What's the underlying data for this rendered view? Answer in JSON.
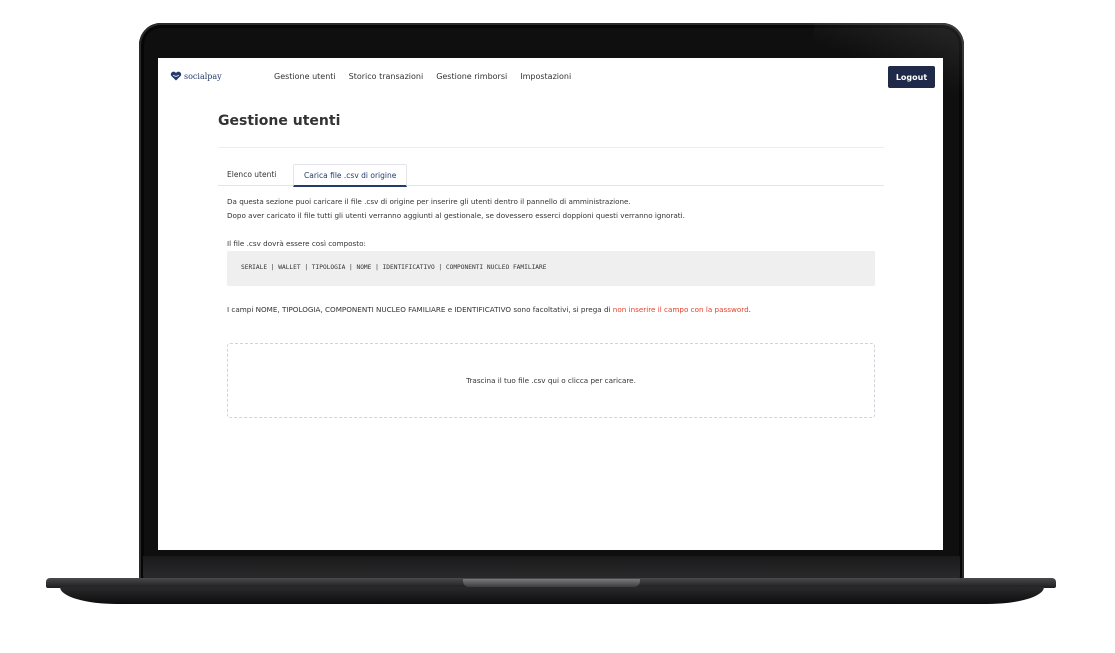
{
  "app": {
    "brand": "socialpay",
    "brand_color": "#243b6b"
  },
  "nav": {
    "items": [
      {
        "label": "Gestione utenti"
      },
      {
        "label": "Storico transazioni"
      },
      {
        "label": "Gestione rimborsi"
      },
      {
        "label": "Impostazioni"
      }
    ],
    "logout_label": "Logout"
  },
  "page": {
    "title": "Gestione utenti"
  },
  "tabs": [
    {
      "label": "Elenco utenti",
      "active": false
    },
    {
      "label": "Carica file .csv di origine",
      "active": true
    }
  ],
  "upload": {
    "desc_line1": "Da questa sezione puoi caricare il file .csv di origine per inserire gli utenti dentro il pannello di amministrazione.",
    "desc_line2": "Dopo aver caricato il file tutti gli utenti verranno aggiunti al gestionale, se dovessero esserci doppioni questi verranno ignorati.",
    "format_intro": "Il file .csv dovrà essere così composto:",
    "format_code": "SERIALE | WALLET | TIPOLOGIA | NOME | IDENTIFICATIVO | COMPONENTI NUCLEO FAMILIARE",
    "note_text": "I campi NOME, TIPOLOGIA, COMPONENTI NUCLEO FAMILIARE e IDENTIFICATIVO sono facoltativi, si prega di ",
    "note_warning": "non inserire il campo con la password",
    "note_end": ".",
    "dropzone_text": "Trascina il tuo file .csv qui o clicca per caricare.",
    "warning_color": "#e8412c"
  }
}
